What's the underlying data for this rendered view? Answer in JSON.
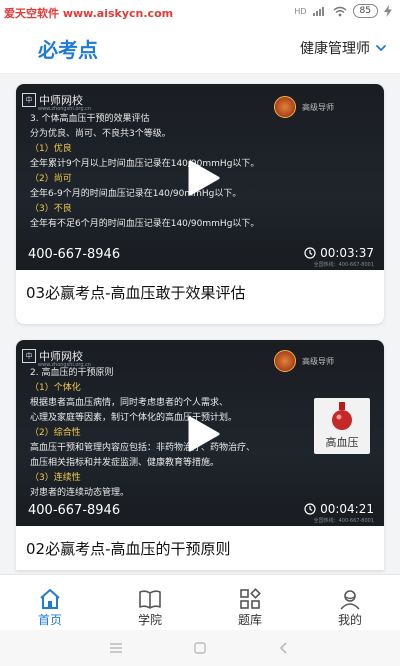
{
  "status_bar": {
    "watermark": "爱天空软件 www.aiskycn.com",
    "signal": "HD",
    "battery": "85"
  },
  "header": {
    "title": "必考点",
    "category": "健康管理师"
  },
  "colors": {
    "accent": "#1e7bd6",
    "highlight": "#f2c94c",
    "watermark": "#e53935"
  },
  "videos": [
    {
      "title": "03必赢考点-高血压敢于效果评估",
      "duration": "00:03:37",
      "phone": "400-667-8946",
      "thumb_brand": "中师网校",
      "thumb_url": "www.zhongshi.org.cn",
      "thumb_seal_text": "高级导师",
      "thumb_tiny_phone": "全国热线：400-667-8001",
      "thumb_lines": [
        "3. 个体高血压干预的效果评估",
        "分为优良、尚可、不良共3个等级。",
        "（1）优良",
        "全年累计9个月以上时间血压记录在140/90mmHg以下。",
        "（2）尚可",
        "全年6-9个月的时间血压记录在140/90mmHg以下。",
        "（3）不良",
        "全年有不足6个月的时间血压记录在140/90mmHg以下。"
      ]
    },
    {
      "title": "02必赢考点-高血压的干预原则",
      "duration": "00:04:21",
      "phone": "400-667-8946",
      "thumb_brand": "中师网校",
      "thumb_url": "www.zhongshi.org.cn",
      "thumb_seal_text": "高级导师",
      "thumb_tiny_phone": "全国热线：400-667-8001",
      "thumb_badge": "高血压",
      "thumb_lines": [
        "2. 高血压的干预原则",
        "（1）个体化",
        "根据患者高血压病情，同时考虑患者的个人需求、",
        "心理及家庭等因素，制订个体化的高血压干预计划。",
        "（2）综合性",
        "高血压干预和管理内容应包括：非药物治疗、药物治疗、",
        "血压相关指标和并发症监测、健康教育等措施。",
        "（3）连续性",
        "对患者的连续动态管理。"
      ]
    }
  ],
  "tabs": [
    {
      "label": "首页",
      "icon": "home-icon",
      "active": true
    },
    {
      "label": "学院",
      "icon": "book-icon",
      "active": false
    },
    {
      "label": "题库",
      "icon": "grid-icon",
      "active": false
    },
    {
      "label": "我的",
      "icon": "user-icon",
      "active": false
    }
  ]
}
